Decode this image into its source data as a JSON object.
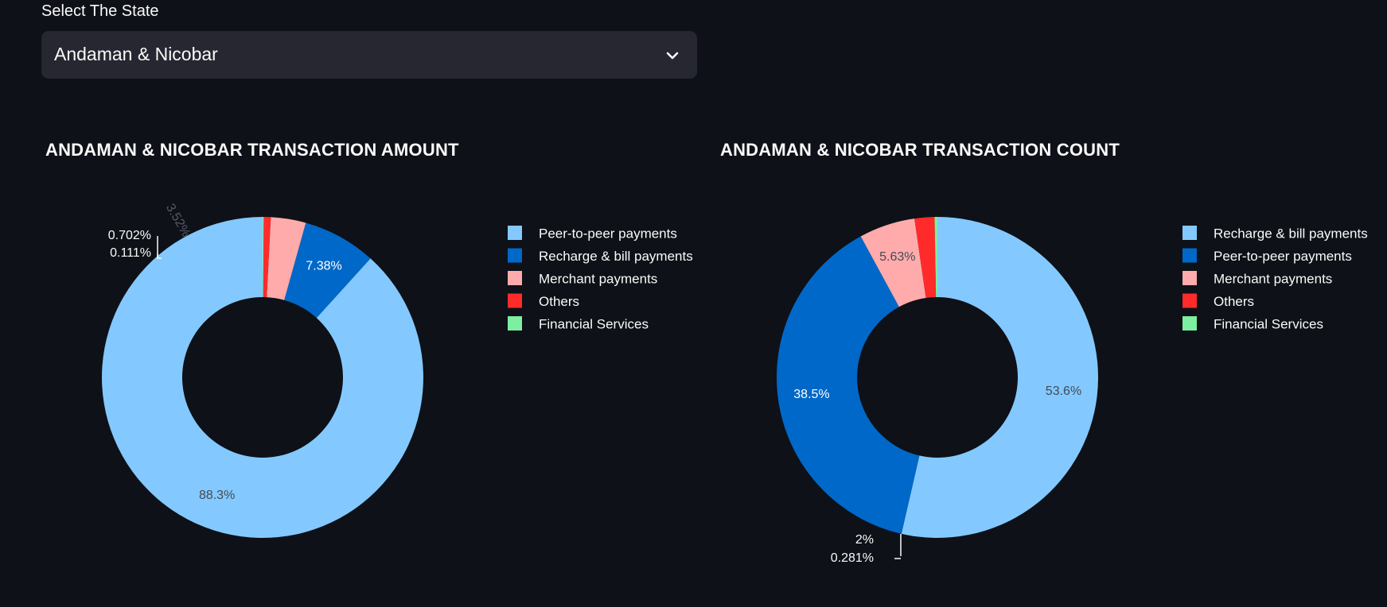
{
  "selector": {
    "label": "Select The State",
    "selected": "Andaman & Nicobar"
  },
  "colors": {
    "background": "#0e1117",
    "select_bg": "#262730",
    "slice_colors": [
      "#83c9ff",
      "#0068c9",
      "#ffabab",
      "#ff2b2b",
      "#7defa1"
    ]
  },
  "chart_data": [
    {
      "type": "pie",
      "hole": true,
      "title": "ANDAMAN & NICOBAR TRANSACTION AMOUNT",
      "legend_position": "right",
      "slices": [
        {
          "name": "Peer-to-peer payments",
          "value": 88.3,
          "label": "88.3%",
          "color": "#83c9ff"
        },
        {
          "name": "Recharge & bill payments",
          "value": 7.38,
          "label": "7.38%",
          "color": "#0068c9"
        },
        {
          "name": "Merchant payments",
          "value": 3.52,
          "label": "3.52%",
          "color": "#ffabab"
        },
        {
          "name": "Others",
          "value": 0.702,
          "label": "0.702%",
          "color": "#ff2b2b"
        },
        {
          "name": "Financial Services",
          "value": 0.111,
          "label": "0.111%",
          "color": "#7defa1"
        }
      ]
    },
    {
      "type": "pie",
      "hole": true,
      "title": "ANDAMAN & NICOBAR TRANSACTION COUNT",
      "legend_position": "right",
      "slices": [
        {
          "name": "Recharge & bill payments",
          "value": 53.6,
          "label": "53.6%",
          "color": "#83c9ff"
        },
        {
          "name": "Peer-to-peer payments",
          "value": 38.5,
          "label": "38.5%",
          "color": "#0068c9"
        },
        {
          "name": "Merchant payments",
          "value": 5.63,
          "label": "5.63%",
          "color": "#ffabab"
        },
        {
          "name": "Others",
          "value": 2,
          "label": "2%",
          "color": "#ff2b2b"
        },
        {
          "name": "Financial Services",
          "value": 0.281,
          "label": "0.281%",
          "color": "#7defa1"
        }
      ]
    }
  ]
}
